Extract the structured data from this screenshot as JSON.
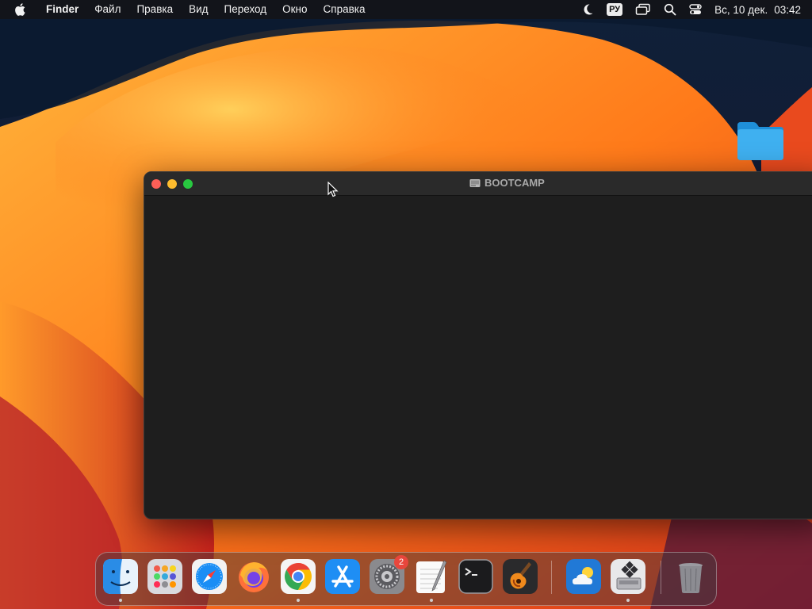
{
  "menubar": {
    "app_name": "Finder",
    "items": [
      "Файл",
      "Правка",
      "Вид",
      "Переход",
      "Окно",
      "Справка"
    ],
    "input_language": "РУ",
    "date": "Вс, 10 дек.",
    "time": "03:42"
  },
  "window": {
    "title": "BOOTCAMP"
  },
  "dock": {
    "apps": [
      "finder-icon",
      "launchpad-icon",
      "safari-icon",
      "firefox-icon",
      "chrome-icon",
      "app-store-icon",
      "system-settings-icon",
      "textedit-icon",
      "terminal-icon",
      "garageband-icon"
    ],
    "recent": [
      "weather-icon",
      "bootcamp-assistant-icon"
    ],
    "settings_badge": "2"
  },
  "colors": {
    "close": "#fe5f57",
    "minimize": "#febc2e",
    "maximize": "#28c840",
    "window_bg": "#1e1e1e",
    "titlebar_bg": "#2a2a2a"
  }
}
